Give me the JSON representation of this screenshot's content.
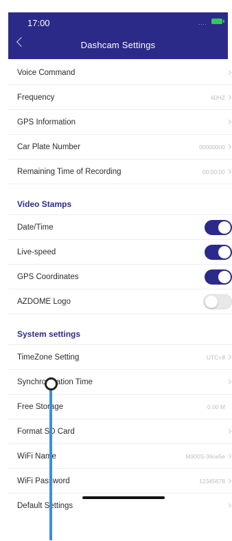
{
  "status_bar": {
    "time": "17:00",
    "signal": "...."
  },
  "header": {
    "title": "Dashcam Settings"
  },
  "rows_top": [
    {
      "label": "Voice Command",
      "value": ""
    },
    {
      "label": "Frequency",
      "value": "60HZ"
    },
    {
      "label": "GPS Information",
      "value": ""
    },
    {
      "label": "Car Plate Number",
      "value": "00000000"
    },
    {
      "label": "Remaining Time of Recording",
      "value": "00:00:00"
    }
  ],
  "video_stamps": {
    "title": "Video Stamps",
    "items": [
      {
        "label": "Date/Time",
        "on": true
      },
      {
        "label": "Live-speed",
        "on": true
      },
      {
        "label": "GPS Coordinates",
        "on": true
      },
      {
        "label": "AZDOME Logo",
        "on": false
      }
    ]
  },
  "system_settings": {
    "title": "System settings",
    "items": [
      {
        "label": "TimeZone Setting",
        "value": "UTC+8"
      },
      {
        "label": "Synchronization Time",
        "value": ""
      },
      {
        "label": "Free Storage",
        "value": "0.00 M"
      },
      {
        "label": "Format SD Card",
        "value": ""
      },
      {
        "label": "WiFi Name",
        "value": "M300S-36ce5e"
      },
      {
        "label": "WiFi Password",
        "value": "12345678"
      },
      {
        "label": "Default Settings",
        "value": ""
      }
    ]
  },
  "colors": {
    "header_bg": "#2c2a88",
    "toggle_on": "#2c2a88",
    "section_title": "#2d2b8a",
    "pointer": "#3a8ee0"
  }
}
